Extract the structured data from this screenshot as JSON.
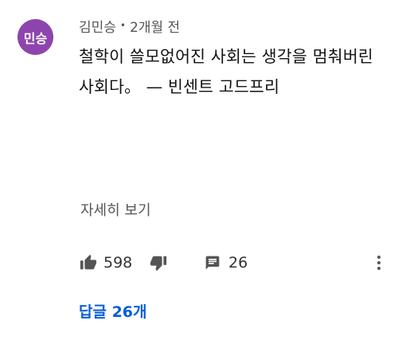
{
  "author": {
    "avatar_text": "민승",
    "name": "김민승",
    "separator": "•",
    "time": "2개월 전"
  },
  "comment": {
    "text": "철학이 쓸모없어진 사회는 생각을 멈춰버린 사회다。 — 빈센트 고드프리"
  },
  "read_more": "자세히 보기",
  "actions": {
    "like_count": "598",
    "reply_count": "26"
  },
  "replies_link": "답글 26개",
  "colors": {
    "avatar_bg": "#8e44ad",
    "link": "#065fd4",
    "icon": "#555555"
  },
  "icons": {
    "like": "thumb-up-icon",
    "dislike": "thumb-down-icon",
    "comment": "comment-icon",
    "menu": "more-vert-icon"
  }
}
